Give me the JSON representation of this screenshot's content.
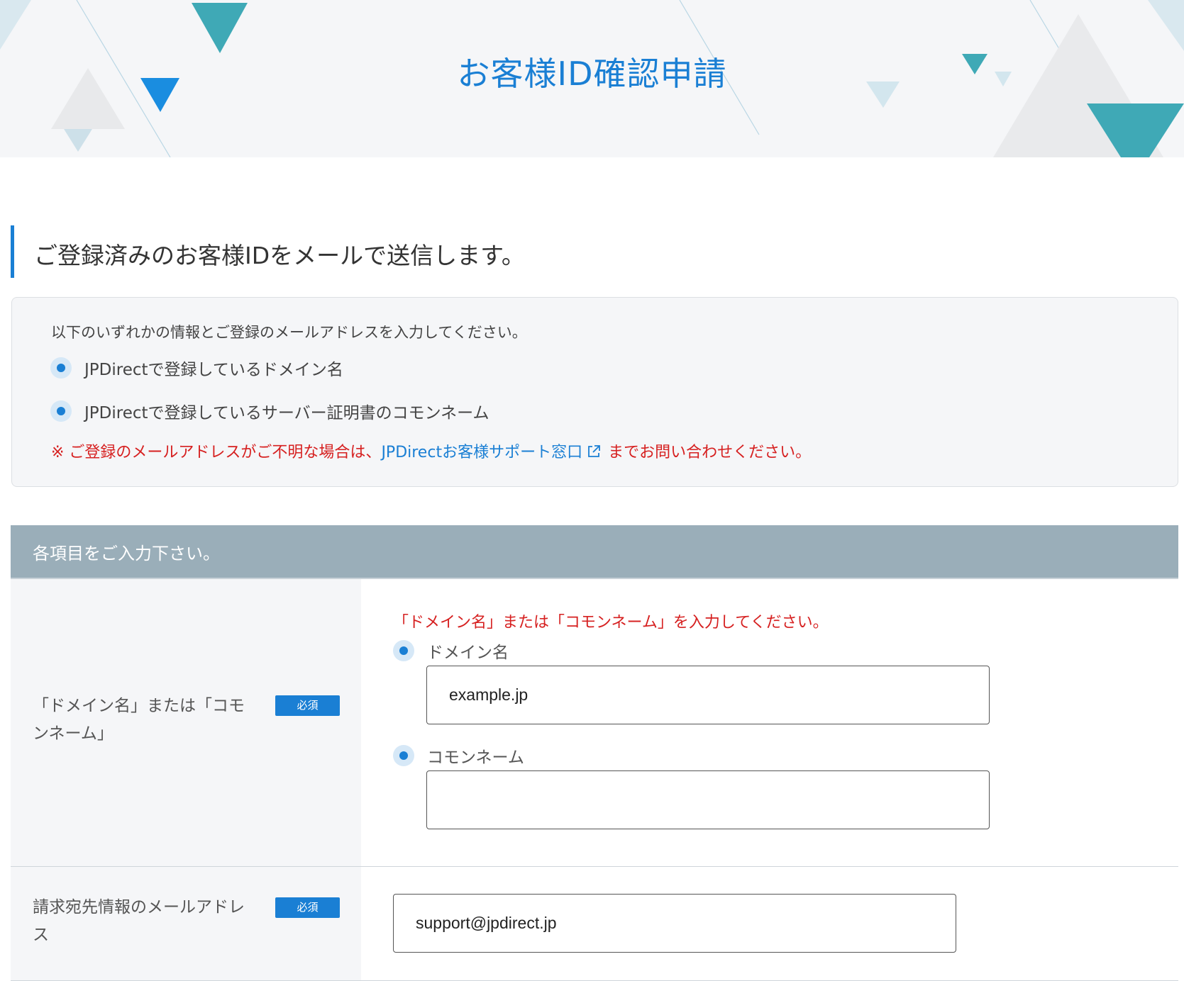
{
  "hero": {
    "title": "お客様ID確認申請"
  },
  "lead": {
    "heading": "ご登録済みのお客様IDをメールで送信します。"
  },
  "info": {
    "intro": "以下のいずれかの情報とご登録のメールアドレスを入力してください。",
    "bullets": [
      "JPDirectで登録しているドメイン名",
      "JPDirectで登録しているサーバー証明書のコモンネーム"
    ],
    "notice_prefix": "※ ご登録のメールアドレスがご不明な場合は、",
    "support_link": "JPDirectお客様サポート窓口",
    "notice_suffix": "までお問い合わせください。"
  },
  "form": {
    "heading": "各項目をご入力下さい。",
    "required_label": "必須",
    "domain_row": {
      "label": "「ドメイン名」または「コモンネーム」",
      "error": "「ドメイン名」または「コモンネーム」を入力してください。",
      "option_domain": "ドメイン名",
      "domain_value": "example.jp",
      "option_common": "コモンネーム",
      "common_value": ""
    },
    "email_row": {
      "label": "請求宛先情報のメールアドレス",
      "value": "support@jpdirect.jp"
    }
  },
  "colors": {
    "accent": "#1a7fd4",
    "error": "#d62020",
    "form_header": "#9aaeb9",
    "panel_bg": "#f5f6f8",
    "deco_teal": "#3fa9b6"
  },
  "icons": {
    "external_link": "external-link-icon",
    "radio": "radio-selected-icon"
  }
}
